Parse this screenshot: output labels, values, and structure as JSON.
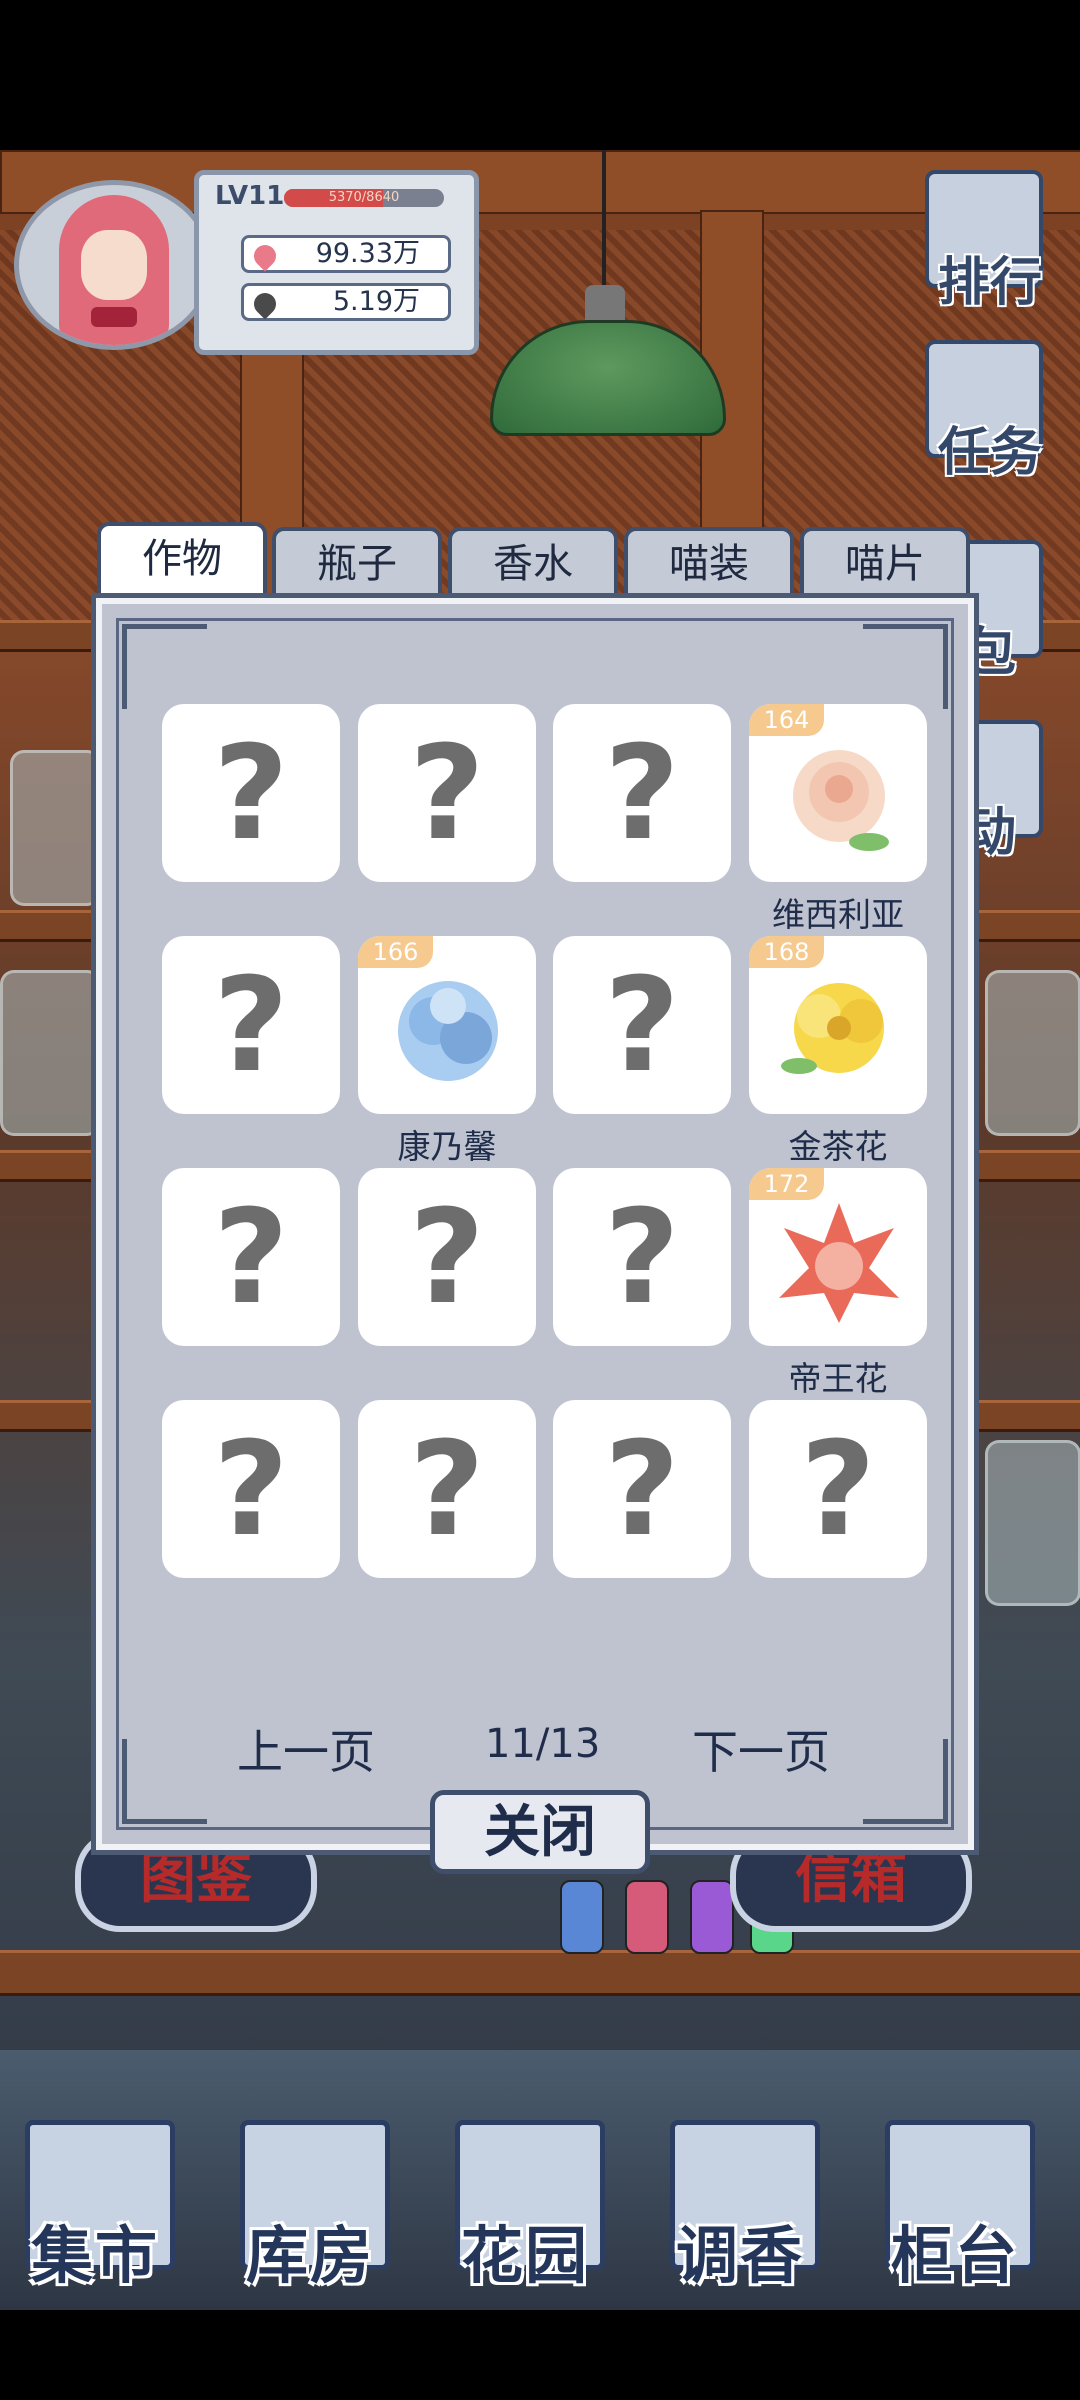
{
  "player": {
    "level": "LV11",
    "xp_text": "5370/8640",
    "xp_fraction": 0.62,
    "petals": "99.33万",
    "leaves": "5.19万"
  },
  "side_menu": [
    "排行",
    "任务",
    "包",
    "动"
  ],
  "tabs": [
    {
      "label": "作物",
      "active": true
    },
    {
      "label": "瓶子",
      "active": false
    },
    {
      "label": "香水",
      "active": false
    },
    {
      "label": "喵装",
      "active": false
    },
    {
      "label": "喵片",
      "active": false
    }
  ],
  "grid": {
    "unknown_symbol": "?",
    "items": [
      {
        "known": false
      },
      {
        "known": false
      },
      {
        "known": false
      },
      {
        "known": true,
        "level": "164",
        "name": "维西利亚",
        "flower": "rose",
        "color": "#f7d9c8"
      },
      {
        "known": false
      },
      {
        "known": true,
        "level": "166",
        "name": "康乃馨",
        "flower": "carnation",
        "color": "#9cc4ec"
      },
      {
        "known": false
      },
      {
        "known": true,
        "level": "168",
        "name": "金茶花",
        "flower": "camellia",
        "color": "#f6d84a"
      },
      {
        "known": false
      },
      {
        "known": false
      },
      {
        "known": false
      },
      {
        "known": true,
        "level": "172",
        "name": "帝王花",
        "flower": "protea",
        "color": "#ea6a5a"
      },
      {
        "known": false
      },
      {
        "known": false
      },
      {
        "known": false
      },
      {
        "known": false
      }
    ]
  },
  "pagination": {
    "prev": "上一页",
    "page": "11/13",
    "next": "下一页"
  },
  "close_label": "关闭",
  "counter_signs": [
    "图鉴",
    "信箱"
  ],
  "bottom_nav": [
    "集市",
    "库房",
    "花园",
    "调香",
    "柜台"
  ]
}
